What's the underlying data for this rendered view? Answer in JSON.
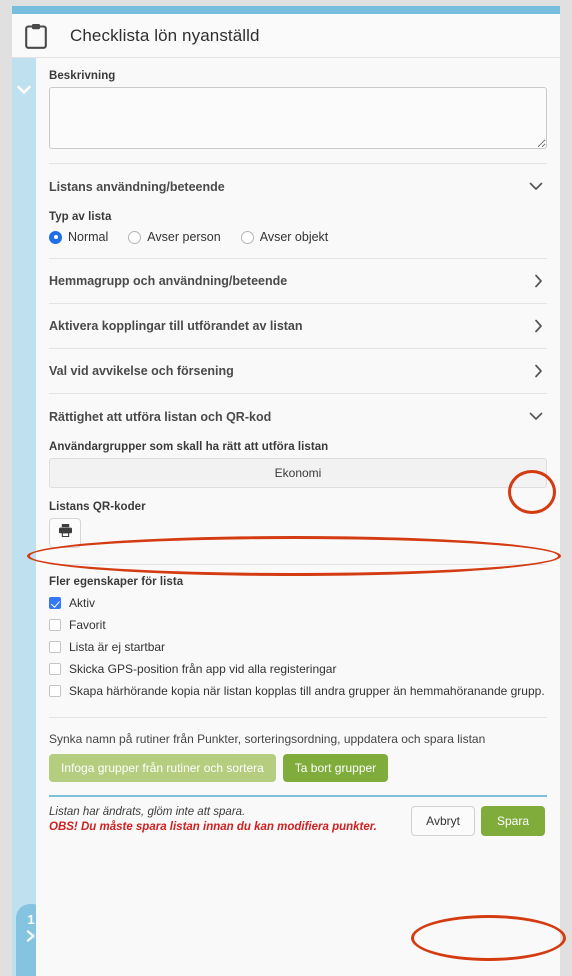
{
  "header": {
    "title": "Checklista lön nyanställd",
    "icon": "clipboard-icon"
  },
  "sidebar": {
    "collapse_icon": "chevron-down-icon",
    "tab_number": "1",
    "tab_icon": "chevron-right-icon"
  },
  "description": {
    "label": "Beskrivning",
    "value": "",
    "placeholder": ""
  },
  "sections": [
    {
      "title": "Listans användning/beteende",
      "chevron": "chevron-down-icon",
      "expanded": true
    },
    {
      "title": "Hemmagrupp och användning/beteende",
      "chevron": "chevron-right-icon",
      "expanded": false
    },
    {
      "title": "Aktivera kopplingar till utförandet av listan",
      "chevron": "chevron-right-icon",
      "expanded": false
    },
    {
      "title": "Val vid avvikelse och försening",
      "chevron": "chevron-right-icon",
      "expanded": false
    },
    {
      "title": "Rättighet att utföra listan och QR-kod",
      "chevron": "chevron-down-icon",
      "expanded": true
    }
  ],
  "list_type": {
    "label": "Typ av lista",
    "options": [
      {
        "label": "Normal",
        "selected": true
      },
      {
        "label": "Avser person",
        "selected": false
      },
      {
        "label": "Avser objekt",
        "selected": false
      }
    ]
  },
  "permissions": {
    "label": "Användargrupper som skall ha rätt att utföra listan",
    "selected_group": "Ekonomi"
  },
  "qr": {
    "label": "Listans QR-koder",
    "print_icon": "printer-icon"
  },
  "more_properties": {
    "label": "Fler egenskaper för lista",
    "items": [
      {
        "label": "Aktiv",
        "checked": true
      },
      {
        "label": "Favorit",
        "checked": false
      },
      {
        "label": "Lista är ej startbar",
        "checked": false
      },
      {
        "label": "Skicka GPS-position från app vid alla registeringar",
        "checked": false
      },
      {
        "label": "Skapa härhörande kopia när listan kopplas till andra grupper än hemmahöranande grupp.",
        "checked": false
      }
    ]
  },
  "sync": {
    "text": "Synka namn på rutiner från Punkter, sorteringsordning, uppdatera och spara listan",
    "insert_button": "Infoga grupper från rutiner och sortera",
    "remove_button": "Ta bort grupper"
  },
  "footer": {
    "message": "Listan har ändrats, glöm inte att spara.",
    "warning": "OBS! Du måste spara listan innan du kan modifiera punkter.",
    "cancel_label": "Avbryt",
    "save_label": "Spara"
  },
  "colors": {
    "accent_blue": "#76bedd",
    "sidebar_blue": "#bfe0ef",
    "sidebar_tab_blue": "#84c4e0",
    "green_light": "#b5cd7f",
    "green_dark": "#7fac3b",
    "warning_red": "#cf1f1f",
    "annotation_red": "#d43b11",
    "radio_blue": "#1f6fe8"
  }
}
